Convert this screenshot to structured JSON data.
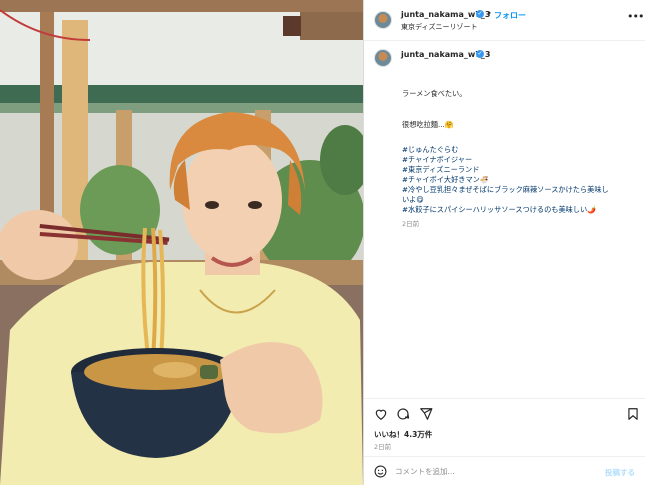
{
  "post": {
    "username": "junta_nakama_w7_3",
    "verified_mark": "✓",
    "separator": "•",
    "follow_label": "フォロー",
    "location": "東京ディズニーリゾート",
    "more_icon": "more-options-icon"
  },
  "caption": {
    "username": "junta_nakama_w7_3",
    "lines": [
      "ラーメン食べたい。",
      "很想吃拉麵...🤗"
    ],
    "hashtags": [
      "#じゅんたぐらむ",
      "#チャイナボイジャー",
      "#東京ディズニーランド",
      "#チャイボイ大好きマン🍜",
      "#冷やし豆乳担々まぜそばにブラック麻辣ソースかけたら美味し",
      "#水餃子にスパイシーハリッサソースつけるのも美味しい🌶️"
    ],
    "hashtag_wrap_line": "いよ😋",
    "time_ago": "2日前"
  },
  "actions": {
    "like_icon": "heart-icon",
    "comment_icon": "comment-icon",
    "share_icon": "share-icon",
    "save_icon": "bookmark-icon"
  },
  "likes_text": "いいね！4.3万件",
  "posted_ago": "2日前",
  "comment_bar": {
    "emoji_icon": "emoji-icon",
    "placeholder": "コメントを追加...",
    "post_label": "投稿する"
  },
  "colors": {
    "link_blue": "#0095f6",
    "hashtag": "#00376b",
    "muted": "#8e8e8e",
    "verified": "#3897f0"
  }
}
